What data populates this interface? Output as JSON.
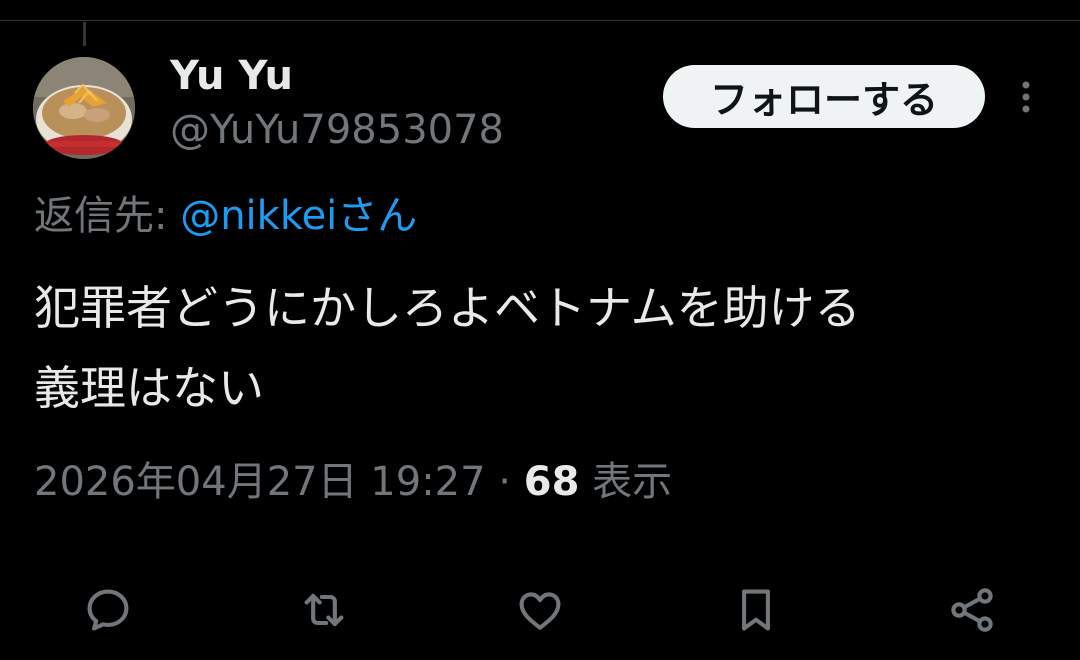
{
  "author": {
    "display_name": "Yu Yu",
    "handle": "@YuYu79853078"
  },
  "follow_button": {
    "label": "フォローする"
  },
  "reply": {
    "prefix": "返信先: ",
    "mention": "@nikkeiさん"
  },
  "tweet": {
    "text": "犯罪者どうにかしろよベトナムを助ける\n義理はない"
  },
  "meta": {
    "timestamp": "2026年04月27日 19:27",
    "separator": " · ",
    "views_count": "68",
    "views_label": " 表示"
  },
  "icons": {
    "more": "more-vertical-icon",
    "reply": "reply-icon",
    "retweet": "retweet-icon",
    "like": "like-icon",
    "bookmark": "bookmark-icon",
    "share": "share-icon"
  },
  "colors": {
    "background": "#000000",
    "text_primary": "#e7e9ea",
    "text_secondary": "#71767b",
    "accent": "#1d9bf0",
    "follow_bg": "#eff3f4",
    "follow_text": "#0f1419"
  }
}
